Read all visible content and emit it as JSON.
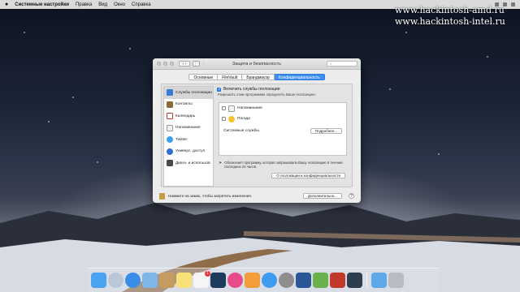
{
  "menubar": {
    "apple": "",
    "app_name": "Системные настройки",
    "items": [
      "Правка",
      "Вид",
      "Окно",
      "Справка"
    ]
  },
  "watermark": {
    "line1": "www.hackintosh-amd.ru",
    "line2": "www.hackintosh-intel.ru"
  },
  "window": {
    "title": "Защита и безопасность",
    "search_placeholder": "Поиск",
    "nav_back": "‹",
    "nav_forward": "›",
    "grid": "⋮⋮⋮",
    "tabs": [
      {
        "label": "Основные",
        "active": false
      },
      {
        "label": "FileVault",
        "active": false
      },
      {
        "label": "Брандмауэр",
        "active": false
      },
      {
        "label": "Конфиденциальность",
        "active": true
      }
    ],
    "sidebar": [
      {
        "label": "Службы геолокации",
        "icon": "location-icon",
        "color": "#3a7bd5",
        "selected": true
      },
      {
        "label": "Контакты",
        "icon": "contacts-icon",
        "color": "#8a6a3c",
        "selected": false
      },
      {
        "label": "Календарь",
        "icon": "calendar-icon",
        "color": "#ffffff",
        "selected": false
      },
      {
        "label": "Напоминания",
        "icon": "reminders-icon",
        "color": "#f2f2f2",
        "selected": false
      },
      {
        "label": "Twitter",
        "icon": "twitter-icon",
        "color": "#3ea1ec",
        "selected": false
      },
      {
        "label": "Универс. доступ",
        "icon": "accessibility-icon",
        "color": "#2d6fd6",
        "selected": false
      },
      {
        "label": "Диагн. и использов.",
        "icon": "diagnostics-icon",
        "color": "#4a4a4a",
        "selected": false
      }
    ],
    "enable_label": "Включить службы геолокации",
    "enable_checked": true,
    "sub_label": "Разрешить этим программам определять Ваше геопозицию:",
    "apps": [
      {
        "label": "Напоминания",
        "checked": false,
        "icon": "reminders-app-icon",
        "color": "#f4f4f4"
      },
      {
        "label": "Погода",
        "checked": false,
        "icon": "weather-app-icon",
        "color": "#f4c430"
      }
    ],
    "system_services_label": "Системные службы",
    "details_button": "Подробнее...",
    "note": "Обозначает программу, которая запрашивала Вашу геопозицию в течение последних 24 часов.",
    "note_arrow": "➤",
    "privacy_button": "О геолокации и конфиденциальности",
    "lock_text": "Нажмите на замок, чтобы запретить изменения.",
    "advanced_button": "Дополнительно...",
    "help": "?"
  },
  "dock": {
    "apps": [
      {
        "name": "finder-icon",
        "color": "#4aa3f0"
      },
      {
        "name": "launchpad-icon",
        "color": "#b9c7d8"
      },
      {
        "name": "safari-icon",
        "color": "#3b8ee8"
      },
      {
        "name": "mail-icon",
        "color": "#7fb6e8"
      },
      {
        "name": "contacts-dock-icon",
        "color": "#c59b60"
      },
      {
        "name": "notes-icon",
        "color": "#f7e27a"
      },
      {
        "name": "reminders-dock-icon",
        "color": "#f5f5f5"
      },
      {
        "name": "photoshop-icon",
        "color": "#1d3b5c"
      },
      {
        "name": "itunes-icon",
        "color": "#e74b8a"
      },
      {
        "name": "ibooks-icon",
        "color": "#f39c3a"
      },
      {
        "name": "appstore-icon",
        "color": "#3d9cf0"
      },
      {
        "name": "system-preferences-icon",
        "color": "#8d8d8d"
      },
      {
        "name": "word-icon",
        "color": "#2b5797"
      },
      {
        "name": "puzzle-icon",
        "color": "#6ab04c"
      },
      {
        "name": "video-icon",
        "color": "#c0392b"
      },
      {
        "name": "display-icon",
        "color": "#2c3e50"
      },
      {
        "name": "folder-icon",
        "color": "#5fa8e8"
      },
      {
        "name": "trash-icon",
        "color": "#b8bcc2"
      }
    ],
    "reminders_badge": "1"
  }
}
